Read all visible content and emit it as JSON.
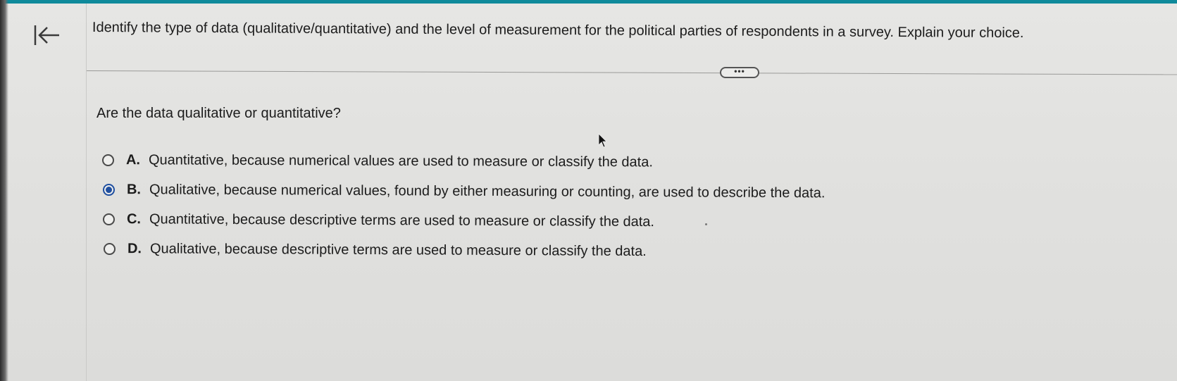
{
  "header": {
    "question": "Identify the type of data (qualitative/quantitative) and the level of measurement for the political parties of respondents in a survey. Explain your choice.",
    "more_label": "•••"
  },
  "nav": {
    "back_icon": "arrow-left-to-bar-icon"
  },
  "main": {
    "sub_question": "Are the data qualitative or quantitative?",
    "options": [
      {
        "letter": "A.",
        "text": "Quantitative, because numerical values are used to measure or classify the data.",
        "selected": false
      },
      {
        "letter": "B.",
        "text": "Qualitative, because numerical values, found by either measuring or counting, are used to describe the data.",
        "selected": true
      },
      {
        "letter": "C.",
        "text": "Quantitative, because descriptive terms are used to measure or classify the data.",
        "selected": false
      },
      {
        "letter": "D.",
        "text": "Qualitative, because descriptive terms are used to measure or classify the data.",
        "selected": false
      }
    ]
  },
  "colors": {
    "accent": "#0f8a9b",
    "radio_selected": "#1f4fa0"
  }
}
